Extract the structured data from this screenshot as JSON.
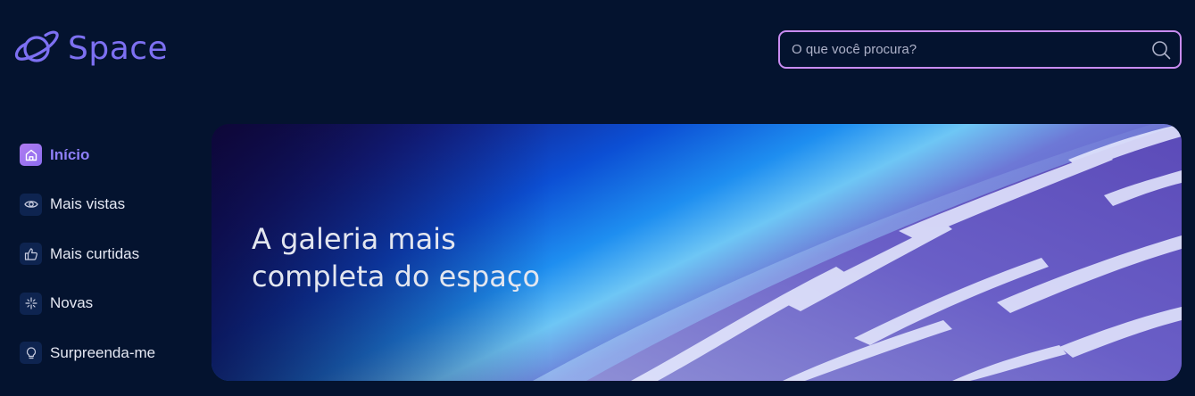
{
  "app": {
    "title": "Space",
    "logo_icon": "planet-icon",
    "brand_color": "#7d70f2"
  },
  "search": {
    "placeholder": "O que você procura?",
    "value": "",
    "icon": "search-icon",
    "border_color": "#c98cf1"
  },
  "sidebar": {
    "items": [
      {
        "label": "Início",
        "icon": "home-icon",
        "active": true
      },
      {
        "label": "Mais vistas",
        "icon": "eye-icon",
        "active": false
      },
      {
        "label": "Mais curtidas",
        "icon": "thumbs-up-icon",
        "active": false
      },
      {
        "label": "Novas",
        "icon": "sparkle-icon",
        "active": false
      },
      {
        "label": "Surpreenda-me",
        "icon": "lightbulb-icon",
        "active": false
      }
    ]
  },
  "banner": {
    "title": "A galeria mais\ncompleta do espaço",
    "image": "earth-from-space-photo"
  },
  "colors": {
    "background": "#04132f",
    "active_nav": "#8e7ff9",
    "nav_text": "#e6e8f3"
  }
}
